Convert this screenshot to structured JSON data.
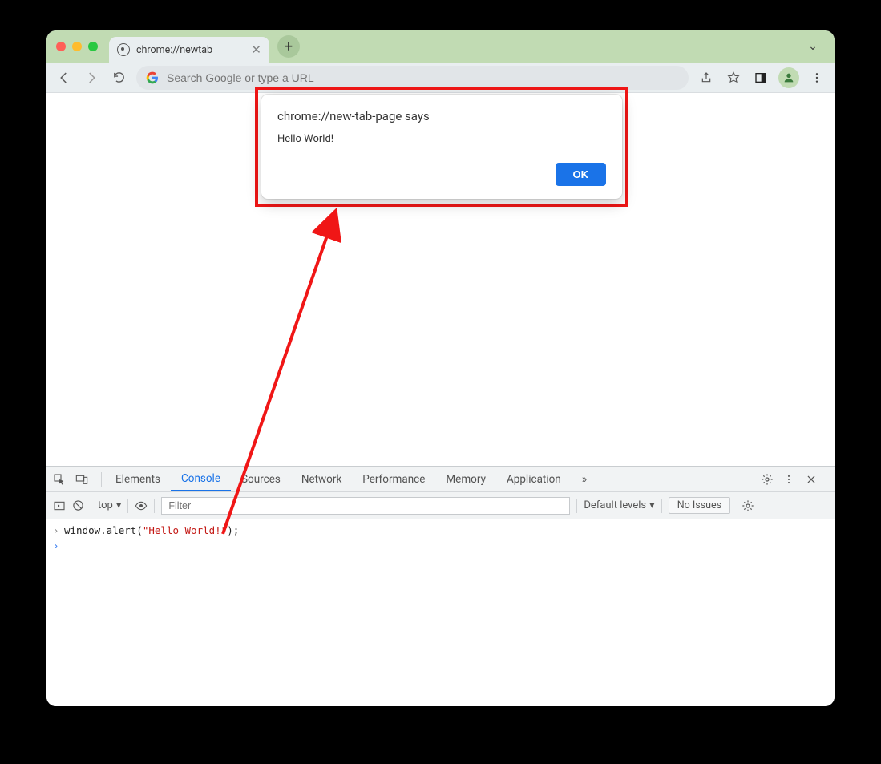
{
  "tabstrip": {
    "tab_title": "chrome://newtab",
    "new_tab_glyph": "+",
    "chevron_glyph": "⌄"
  },
  "toolbar": {
    "address_placeholder": "Search Google or type a URL",
    "address_value": ""
  },
  "dialog": {
    "title": "chrome://new-tab-page says",
    "message": "Hello World!",
    "ok_label": "OK"
  },
  "devtools": {
    "tabs": [
      "Elements",
      "Console",
      "Sources",
      "Network",
      "Performance",
      "Memory",
      "Application"
    ],
    "active_tab": "Console",
    "overflow_glyph": "»",
    "context_label": "top",
    "filter_placeholder": "Filter",
    "levels_label": "Default levels",
    "issues_label": "No Issues",
    "console": {
      "entered_prefix": "window.alert(",
      "entered_string": "\"Hello World!\"",
      "entered_suffix": ");"
    }
  }
}
